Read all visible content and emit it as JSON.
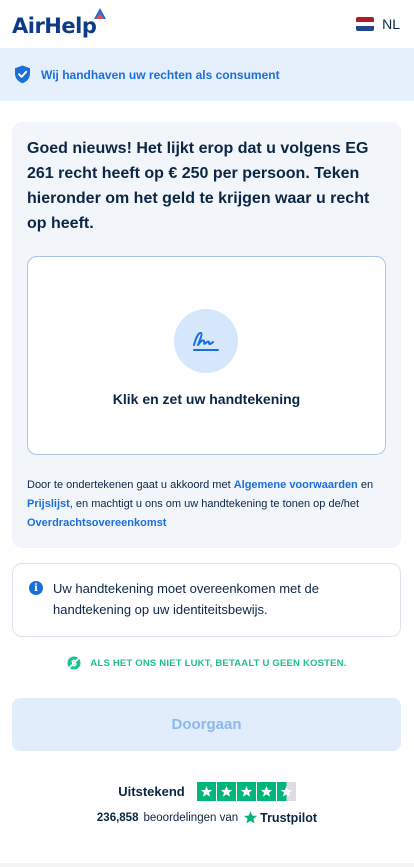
{
  "header": {
    "logo_text": "AirHelp",
    "language": "NL",
    "flag_colors": [
      "#ae1c28",
      "#ffffff",
      "#21468b"
    ]
  },
  "banner": {
    "icon": "shield-check-icon",
    "text": "Wij handhaven uw rechten als consument"
  },
  "card": {
    "headline": "Goed nieuws! Het lijkt erop dat u volgens EG 261 recht heeft op € 250 per persoon. Teken hieronder om het geld te krijgen waar u recht op heeft.",
    "signature_icon": "signature-icon",
    "signature_label": "Klik en zet uw handtekening",
    "terms": {
      "part1": "Door te ondertekenen gaat u akkoord met ",
      "link1": "Algemene voorwaarden",
      "part2": " en ",
      "link2": "Prijslijst",
      "part3": ", en machtigt u ons om uw handtekening te tonen op de/het ",
      "link3": "Overdrachtsovereenkomst"
    }
  },
  "notice": {
    "icon": "info-icon",
    "text": "Uw handtekening moet overeenkomen met de handtekening op uw identiteitsbewijs."
  },
  "guarantee": {
    "icon": "no-fee-icon",
    "text": "ALS HET ONS NIET LUKT, BETAALT U GEEN KOSTEN."
  },
  "cta": {
    "label": "Doorgaan"
  },
  "trustpilot": {
    "rating_label": "Uitstekend",
    "stars": 4.5,
    "count": "236,858",
    "reviews_text": "beoordelingen van",
    "brand": "Trustpilot"
  },
  "colors": {
    "primary": "#1a6fd8",
    "navy": "#0b2545",
    "success": "#1fbf8f",
    "trustpilot_green": "#00b67a"
  }
}
